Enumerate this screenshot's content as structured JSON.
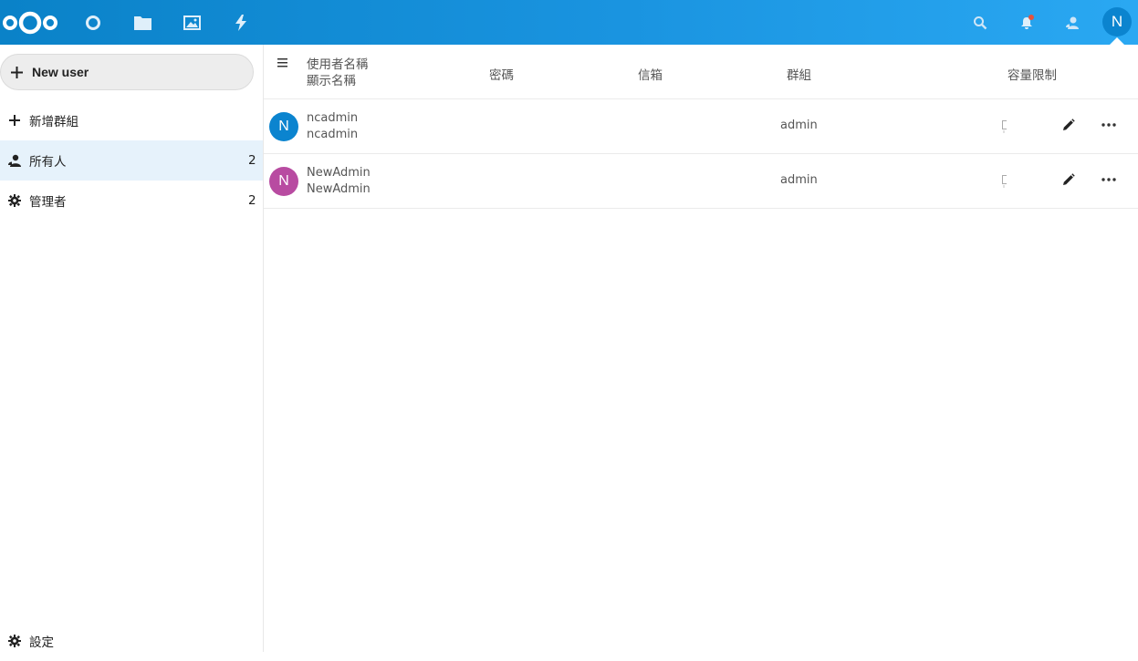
{
  "header": {
    "apps": [
      "dashboard-icon",
      "files-icon",
      "photos-icon",
      "activity-icon"
    ],
    "right_icons": [
      "search-icon",
      "notifications-icon",
      "contacts-icon"
    ],
    "user_initial": "N",
    "brand_color": "#0082c9"
  },
  "sidebar": {
    "new_user_label": "New user",
    "items": [
      {
        "label": "新增群組",
        "count": ""
      },
      {
        "label": "所有人",
        "count": "2"
      },
      {
        "label": "管理者",
        "count": "2"
      }
    ],
    "settings_label": "設定"
  },
  "table": {
    "headers": {
      "username": "使用者名稱",
      "display_name": "顯示名稱",
      "password": "密碼",
      "email": "信箱",
      "groups": "群組",
      "quota": "容量限制"
    },
    "rows": [
      {
        "initial": "N",
        "username": "ncadmin",
        "display_name": "ncadmin",
        "groups": "admin",
        "avatar_color": "#0b84cf"
      },
      {
        "initial": "N",
        "username": "NewAdmin",
        "display_name": "NewAdmin",
        "groups": "admin",
        "avatar_color": "#b84ba1"
      }
    ]
  }
}
